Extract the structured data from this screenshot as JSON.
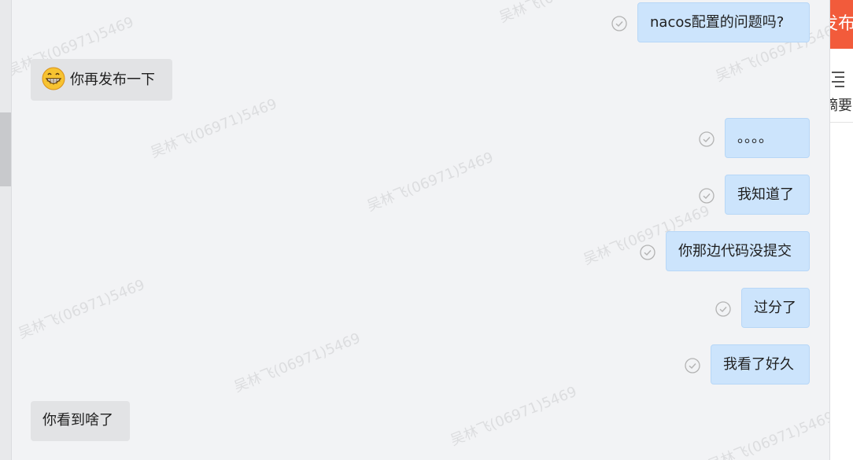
{
  "watermark_text": "吴林飞(06971)5469",
  "messages": [
    {
      "text": "nacos配置的问题吗?",
      "direction": "out"
    },
    {
      "text": "你再发布一下",
      "direction": "in",
      "emoji": "grinning-face-emoji"
    },
    {
      "text": "。。。。",
      "direction": "out"
    },
    {
      "text": "我知道了",
      "direction": "out"
    },
    {
      "text": "你那边代码没提交",
      "direction": "out"
    },
    {
      "text": "过分了",
      "direction": "out"
    },
    {
      "text": "我看了好久",
      "direction": "out"
    },
    {
      "text": "你看到啥了",
      "direction": "in"
    }
  ],
  "right_panel": {
    "publish_label": "发布",
    "summary_label": "摘要"
  },
  "colors": {
    "outgoing_bubble": "#cce4fc",
    "incoming_bubble": "#e2e3e5",
    "publish_button": "#f25b3b",
    "background": "#f2f3f5"
  }
}
